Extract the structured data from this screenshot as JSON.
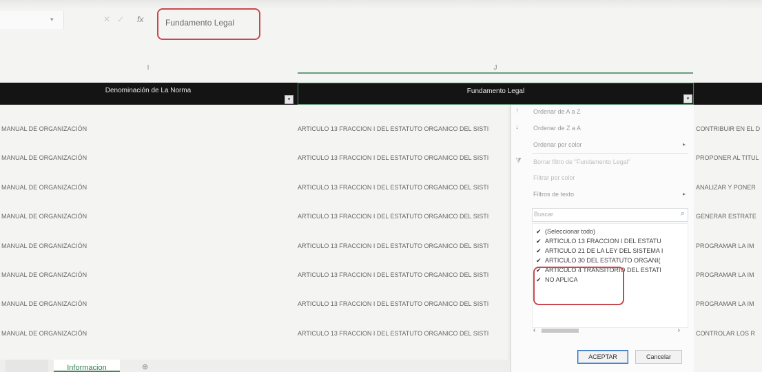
{
  "formula_bar": {
    "name_box_arrow": "▾",
    "cancel_icon": "✕",
    "enter_icon": "✓",
    "fx_label": "fx",
    "content": "Fundamento Legal"
  },
  "column_headers": {
    "left": "I",
    "right": "J"
  },
  "table": {
    "headers": [
      "Denominación de La Norma",
      "Fundamento Legal"
    ],
    "filter_button": "▾",
    "rows": [
      [
        "MANUAL DE ORGANIZACIÓN",
        "ARTICULO 13 FRACCION I DEL ESTATUTO ORGANICO DEL SISTI",
        "CONTRIBUIR EN EL D"
      ],
      [
        "MANUAL DE ORGANIZACIÓN",
        "ARTICULO 13 FRACCION I DEL ESTATUTO ORGANICO DEL SISTI",
        "PROPONER AL TITUL"
      ],
      [
        "MANUAL DE ORGANIZACIÓN",
        "ARTICULO 13 FRACCION I DEL ESTATUTO ORGANICO DEL SISTI",
        "ANALIZAR Y PONER"
      ],
      [
        "MANUAL DE ORGANIZACIÓN",
        "ARTICULO 13 FRACCION I DEL ESTATUTO ORGANICO DEL SISTI",
        "GENERAR ESTRATE"
      ],
      [
        "MANUAL DE ORGANIZACIÓN",
        "ARTICULO 13 FRACCION I DEL ESTATUTO ORGANICO DEL SISTI",
        "PROGRAMAR LA IM"
      ],
      [
        "MANUAL DE ORGANIZACIÓN",
        "ARTICULO 13 FRACCION I DEL ESTATUTO ORGANICO DEL SISTI",
        "PROGRAMAR LA IM"
      ],
      [
        "MANUAL DE ORGANIZACIÓN",
        "ARTICULO 13 FRACCION I DEL ESTATUTO ORGANICO DEL SISTI",
        "PROGRAMAR LA IM"
      ],
      [
        "MANUAL DE ORGANIZACIÓN",
        "ARTICULO 13 FRACCION I DEL ESTATUTO ORGANICO DEL SISTI",
        "CONTROLAR LOS R"
      ]
    ]
  },
  "filter_menu": {
    "sort_asc": "Ordenar de A a Z",
    "sort_desc": "Ordenar de Z a A",
    "sort_by_color": "Ordenar por color",
    "clear_filter": "Borrar filtro de \"Fundamento Legal\"",
    "filter_by_color": "Filtrar por color",
    "text_filters": "Filtros de texto",
    "submenu_arrow": "▸",
    "search_placeholder": "Buscar",
    "search_icon": "⌕",
    "sort_asc_icon": "↑",
    "sort_desc_icon": "↓",
    "funnel_icon": "⧩",
    "check": "✔",
    "items": [
      "(Seleccionar todo)",
      "ARTICULO 13 FRACCION I DEL ESTATU",
      "ARTICULO 21 DE LA LEY DEL SISTEMA I",
      "ARTICULO 30 DEL ESTATUTO ORGANI(",
      "ARTICULO 4 TRANSITORIO DEL ESTATI",
      "NO APLICA"
    ],
    "scroll_left": "‹",
    "scroll_right": "›",
    "ok_label": "ACEPTAR",
    "cancel_label": "Cancelar"
  },
  "sheet_tabs": {
    "active": "Informacion",
    "add": "⊕"
  },
  "colors": {
    "highlight": "#c9484e",
    "header_bg": "#141414",
    "accent": "#3f8a5f"
  }
}
